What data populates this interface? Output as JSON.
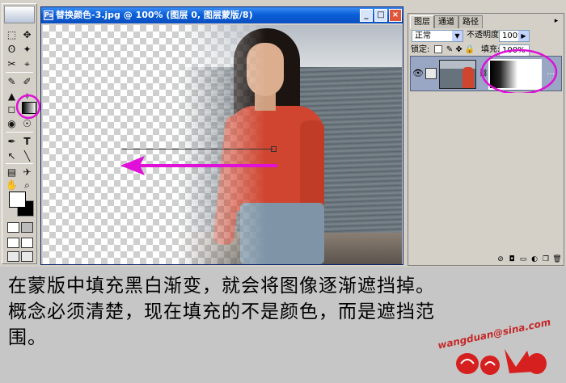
{
  "document": {
    "title": "替换颜色-3.jpg @ 100% (图层 0, 图层蒙版/8)",
    "btn_min": "_",
    "btn_max": "□",
    "btn_close": "×"
  },
  "panel": {
    "tabs": [
      "图层",
      "通道",
      "路径"
    ],
    "blend_mode": "正常",
    "opacity_label": "不透明度:",
    "opacity_value": "100%",
    "lock_label": "锁定:",
    "fill_label": "填充:",
    "fill_value": "100%"
  },
  "toolbox": {
    "tools": [
      "⬚",
      "✥",
      "ʘ",
      "✦",
      "✂",
      "⌖",
      "✎",
      "✐",
      "▲",
      "✧",
      "◻",
      "▭",
      "◉",
      "☉",
      "✒",
      "T",
      "↖",
      "╲",
      "▤",
      "✈",
      "✋",
      "⌕"
    ]
  },
  "caption": {
    "line1": "在蒙版中填充黑白渐变，就会将图像逐渐遮挡掉。",
    "line2": "概念必须清楚，现在填充的不是颜色，而是遮挡范",
    "line3": "围。"
  },
  "watermark": {
    "text": "wangduan@sina.com"
  },
  "colors": {
    "annotation": "#e010d8",
    "title_bar": "#0a5fd8",
    "panel_bg": "#d4d0c8"
  }
}
